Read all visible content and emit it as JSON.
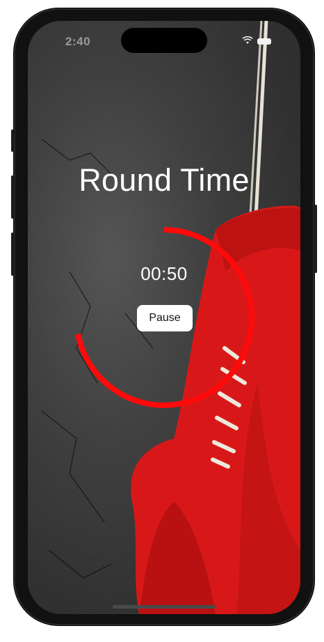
{
  "status_bar": {
    "time": "2:40"
  },
  "screen": {
    "title": "Round Time",
    "timer": "00:50",
    "pause_label": "Pause",
    "progress_fraction_remaining": 0.72
  },
  "colors": {
    "ring": "#ff0a0a",
    "glove": "#e01515",
    "button_bg": "#ffffff",
    "title": "#ffffff"
  },
  "icons": [
    "wifi-icon",
    "battery-icon"
  ]
}
